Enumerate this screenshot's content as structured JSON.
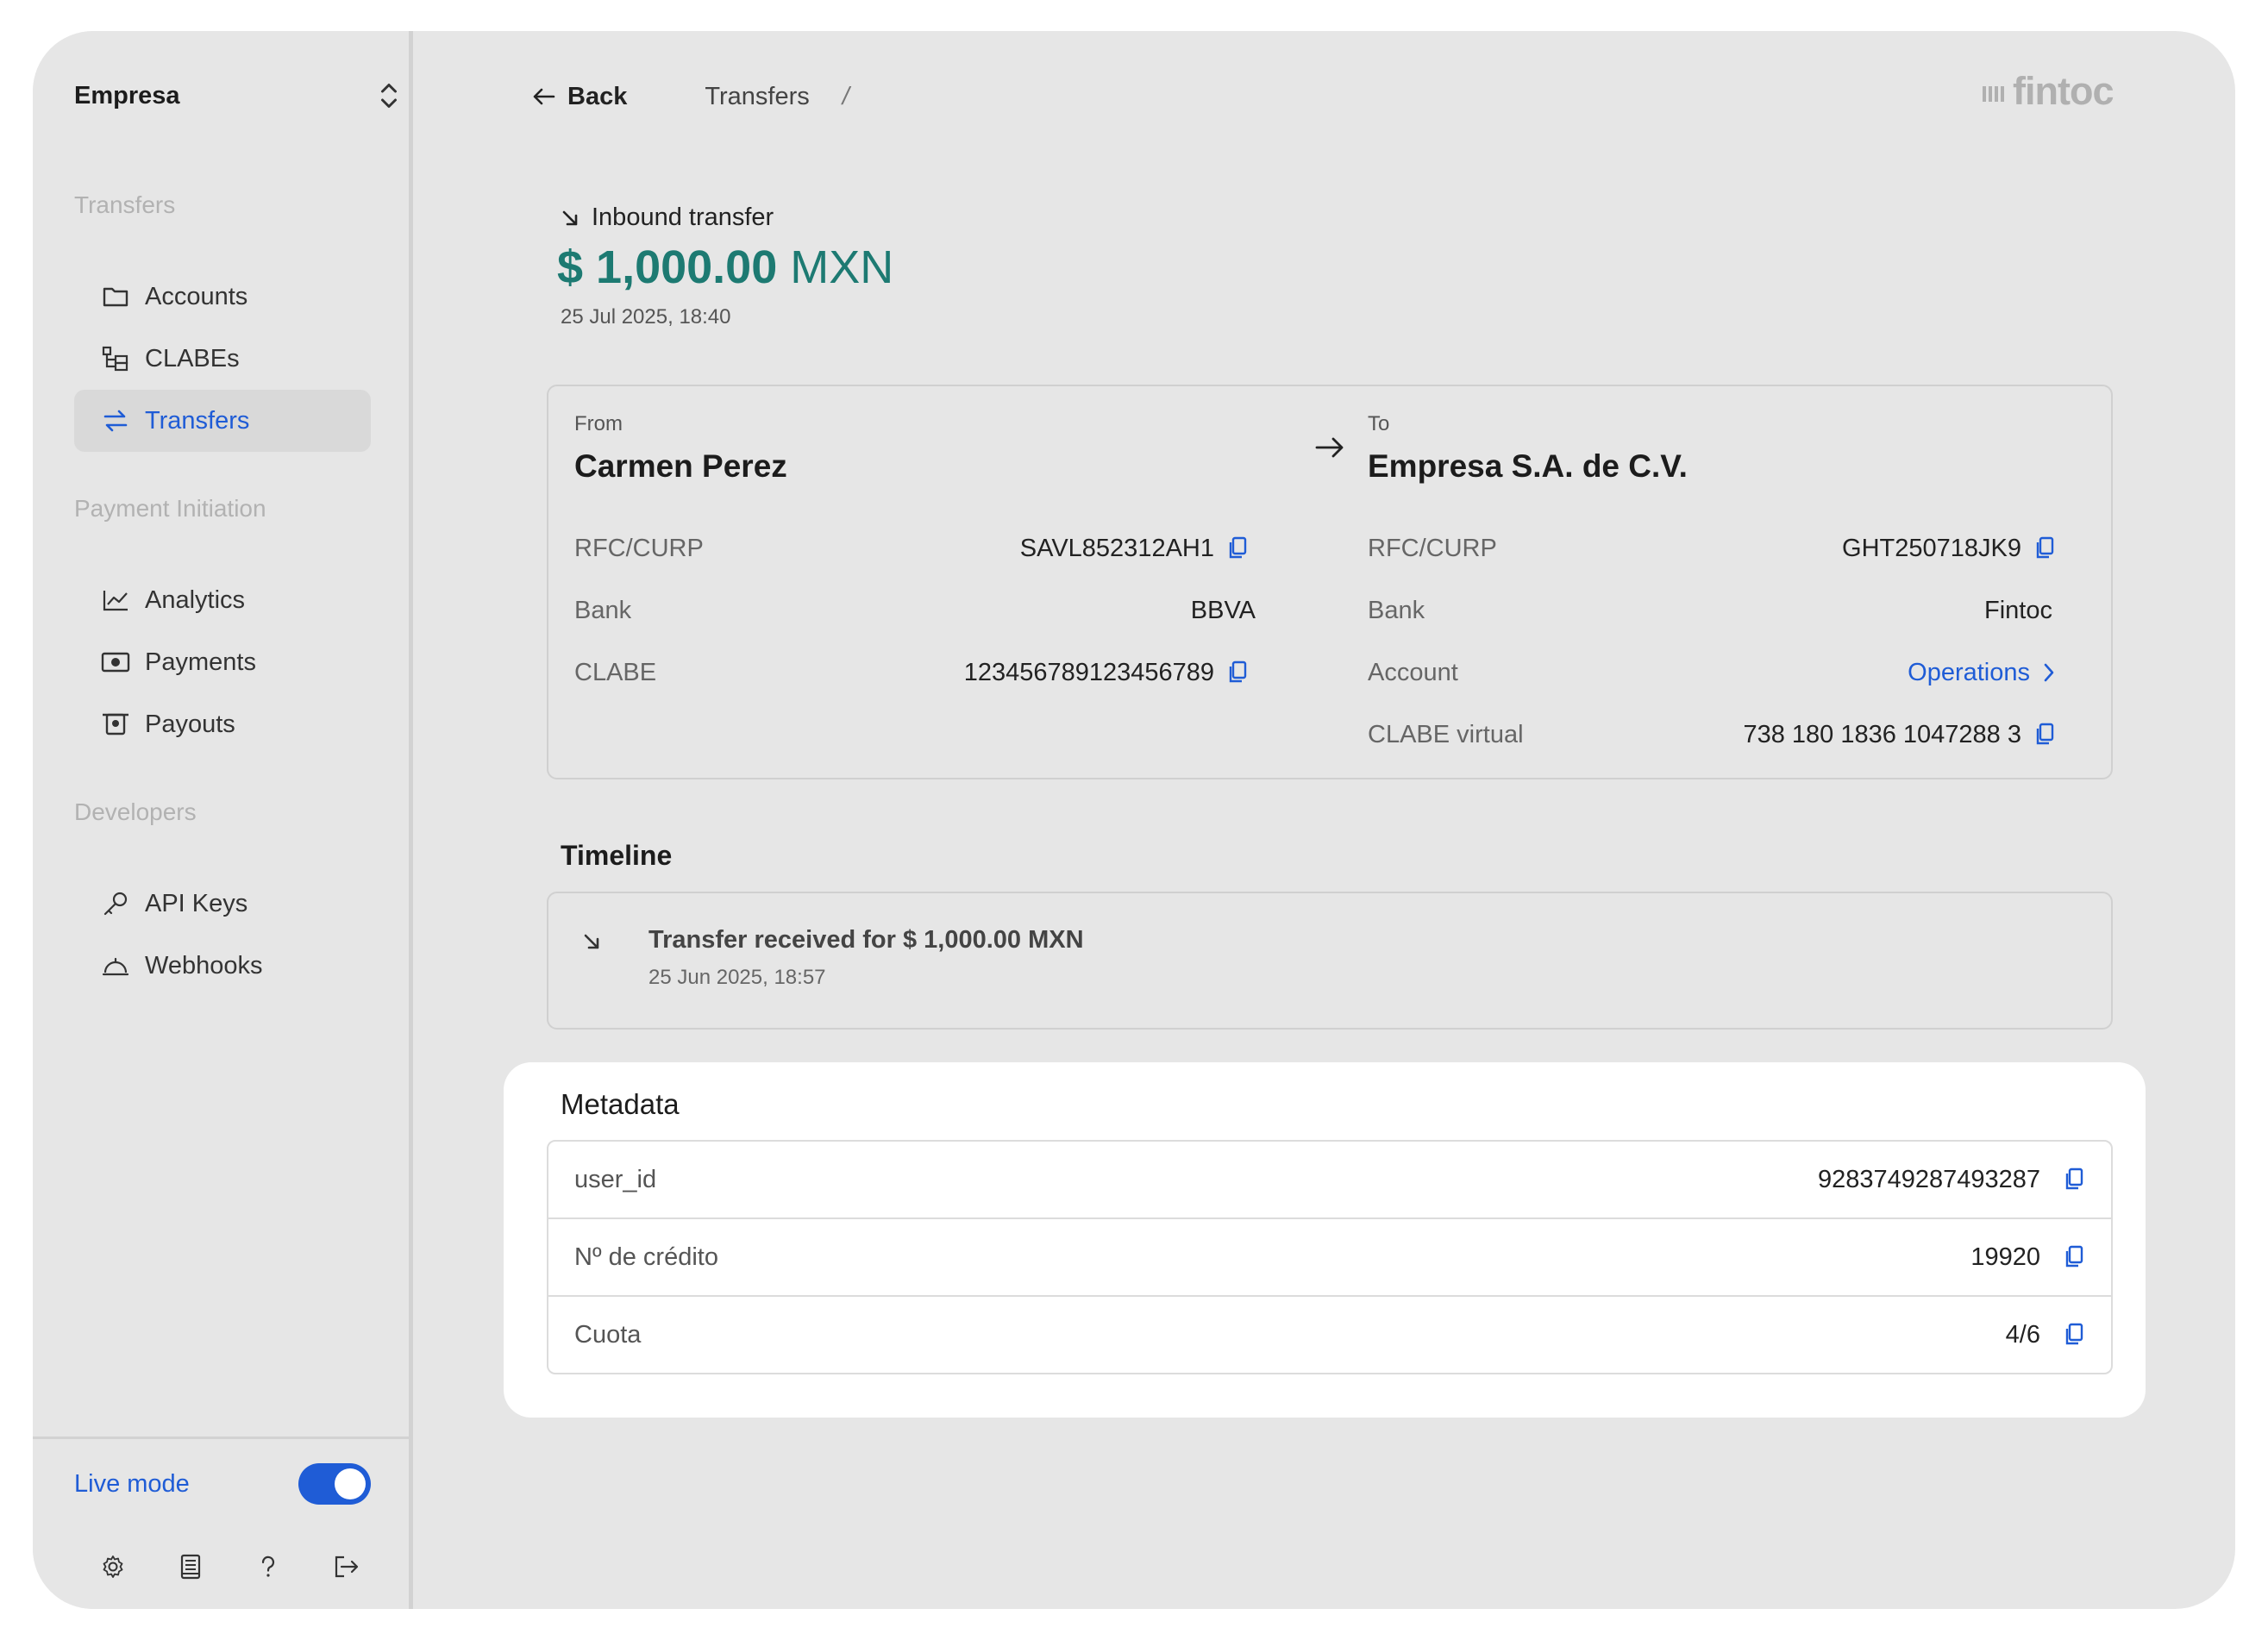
{
  "sidebar": {
    "org_name": "Empresa",
    "sections": [
      {
        "title": "Transfers",
        "items": [
          {
            "label": "Accounts",
            "icon": "folder-icon"
          },
          {
            "label": "CLABEs",
            "icon": "tree-icon"
          },
          {
            "label": "Transfers",
            "icon": "transfer-arrows-icon",
            "active": true
          }
        ]
      },
      {
        "title": "Payment Initiation",
        "items": [
          {
            "label": "Analytics",
            "icon": "chart-line-icon"
          },
          {
            "label": "Payments",
            "icon": "banknote-icon"
          },
          {
            "label": "Payouts",
            "icon": "payout-icon"
          }
        ]
      },
      {
        "title": "Developers",
        "items": [
          {
            "label": "API Keys",
            "icon": "key-icon"
          },
          {
            "label": "Webhooks",
            "icon": "webhook-icon"
          }
        ]
      }
    ],
    "live_mode": {
      "label": "Live mode",
      "on": true
    },
    "footer_icons": [
      "settings-icon",
      "docs-icon",
      "help-icon",
      "logout-icon"
    ]
  },
  "topbar": {
    "back_label": "Back",
    "breadcrumb": "Transfers",
    "separator": "/"
  },
  "brand": {
    "logo_text": "fintoc"
  },
  "transfer": {
    "kind": "Inbound transfer",
    "amount": "$ 1,000.00",
    "currency": "MXN",
    "date": "25 Jul 2025, 18:40"
  },
  "from": {
    "label": "From",
    "name": "Carmen Perez",
    "fields": [
      {
        "key": "RFC/CURP",
        "value": "SAVL852312AH1",
        "copy": true
      },
      {
        "key": "Bank",
        "value": "BBVA",
        "copy": false
      },
      {
        "key": "CLABE",
        "value": "123456789123456789",
        "copy": true
      }
    ]
  },
  "to": {
    "label": "To",
    "name": "Empresa S.A. de C.V.",
    "fields": [
      {
        "key": "RFC/CURP",
        "value": "GHT250718JK9",
        "copy": true
      },
      {
        "key": "Bank",
        "value": "Fintoc",
        "copy": false
      },
      {
        "key": "Account",
        "value": "Operations",
        "link": true
      },
      {
        "key": "CLABE virtual",
        "value": "738 180 1836 1047288 3",
        "copy": true
      }
    ]
  },
  "timeline": {
    "title": "Timeline",
    "events": [
      {
        "title": "Transfer received for $ 1,000.00 MXN",
        "date": "25 Jun 2025, 18:57"
      }
    ]
  },
  "metadata": {
    "title": "Metadata",
    "rows": [
      {
        "key": "user_id",
        "value": "9283749287493287"
      },
      {
        "key": "Nº de crédito",
        "value": "19920"
      },
      {
        "key": "Cuota",
        "value": "4/6"
      }
    ]
  },
  "colors": {
    "accent": "#1f5cd6",
    "amount": "#1d7a72",
    "background": "#e6e6e6"
  }
}
